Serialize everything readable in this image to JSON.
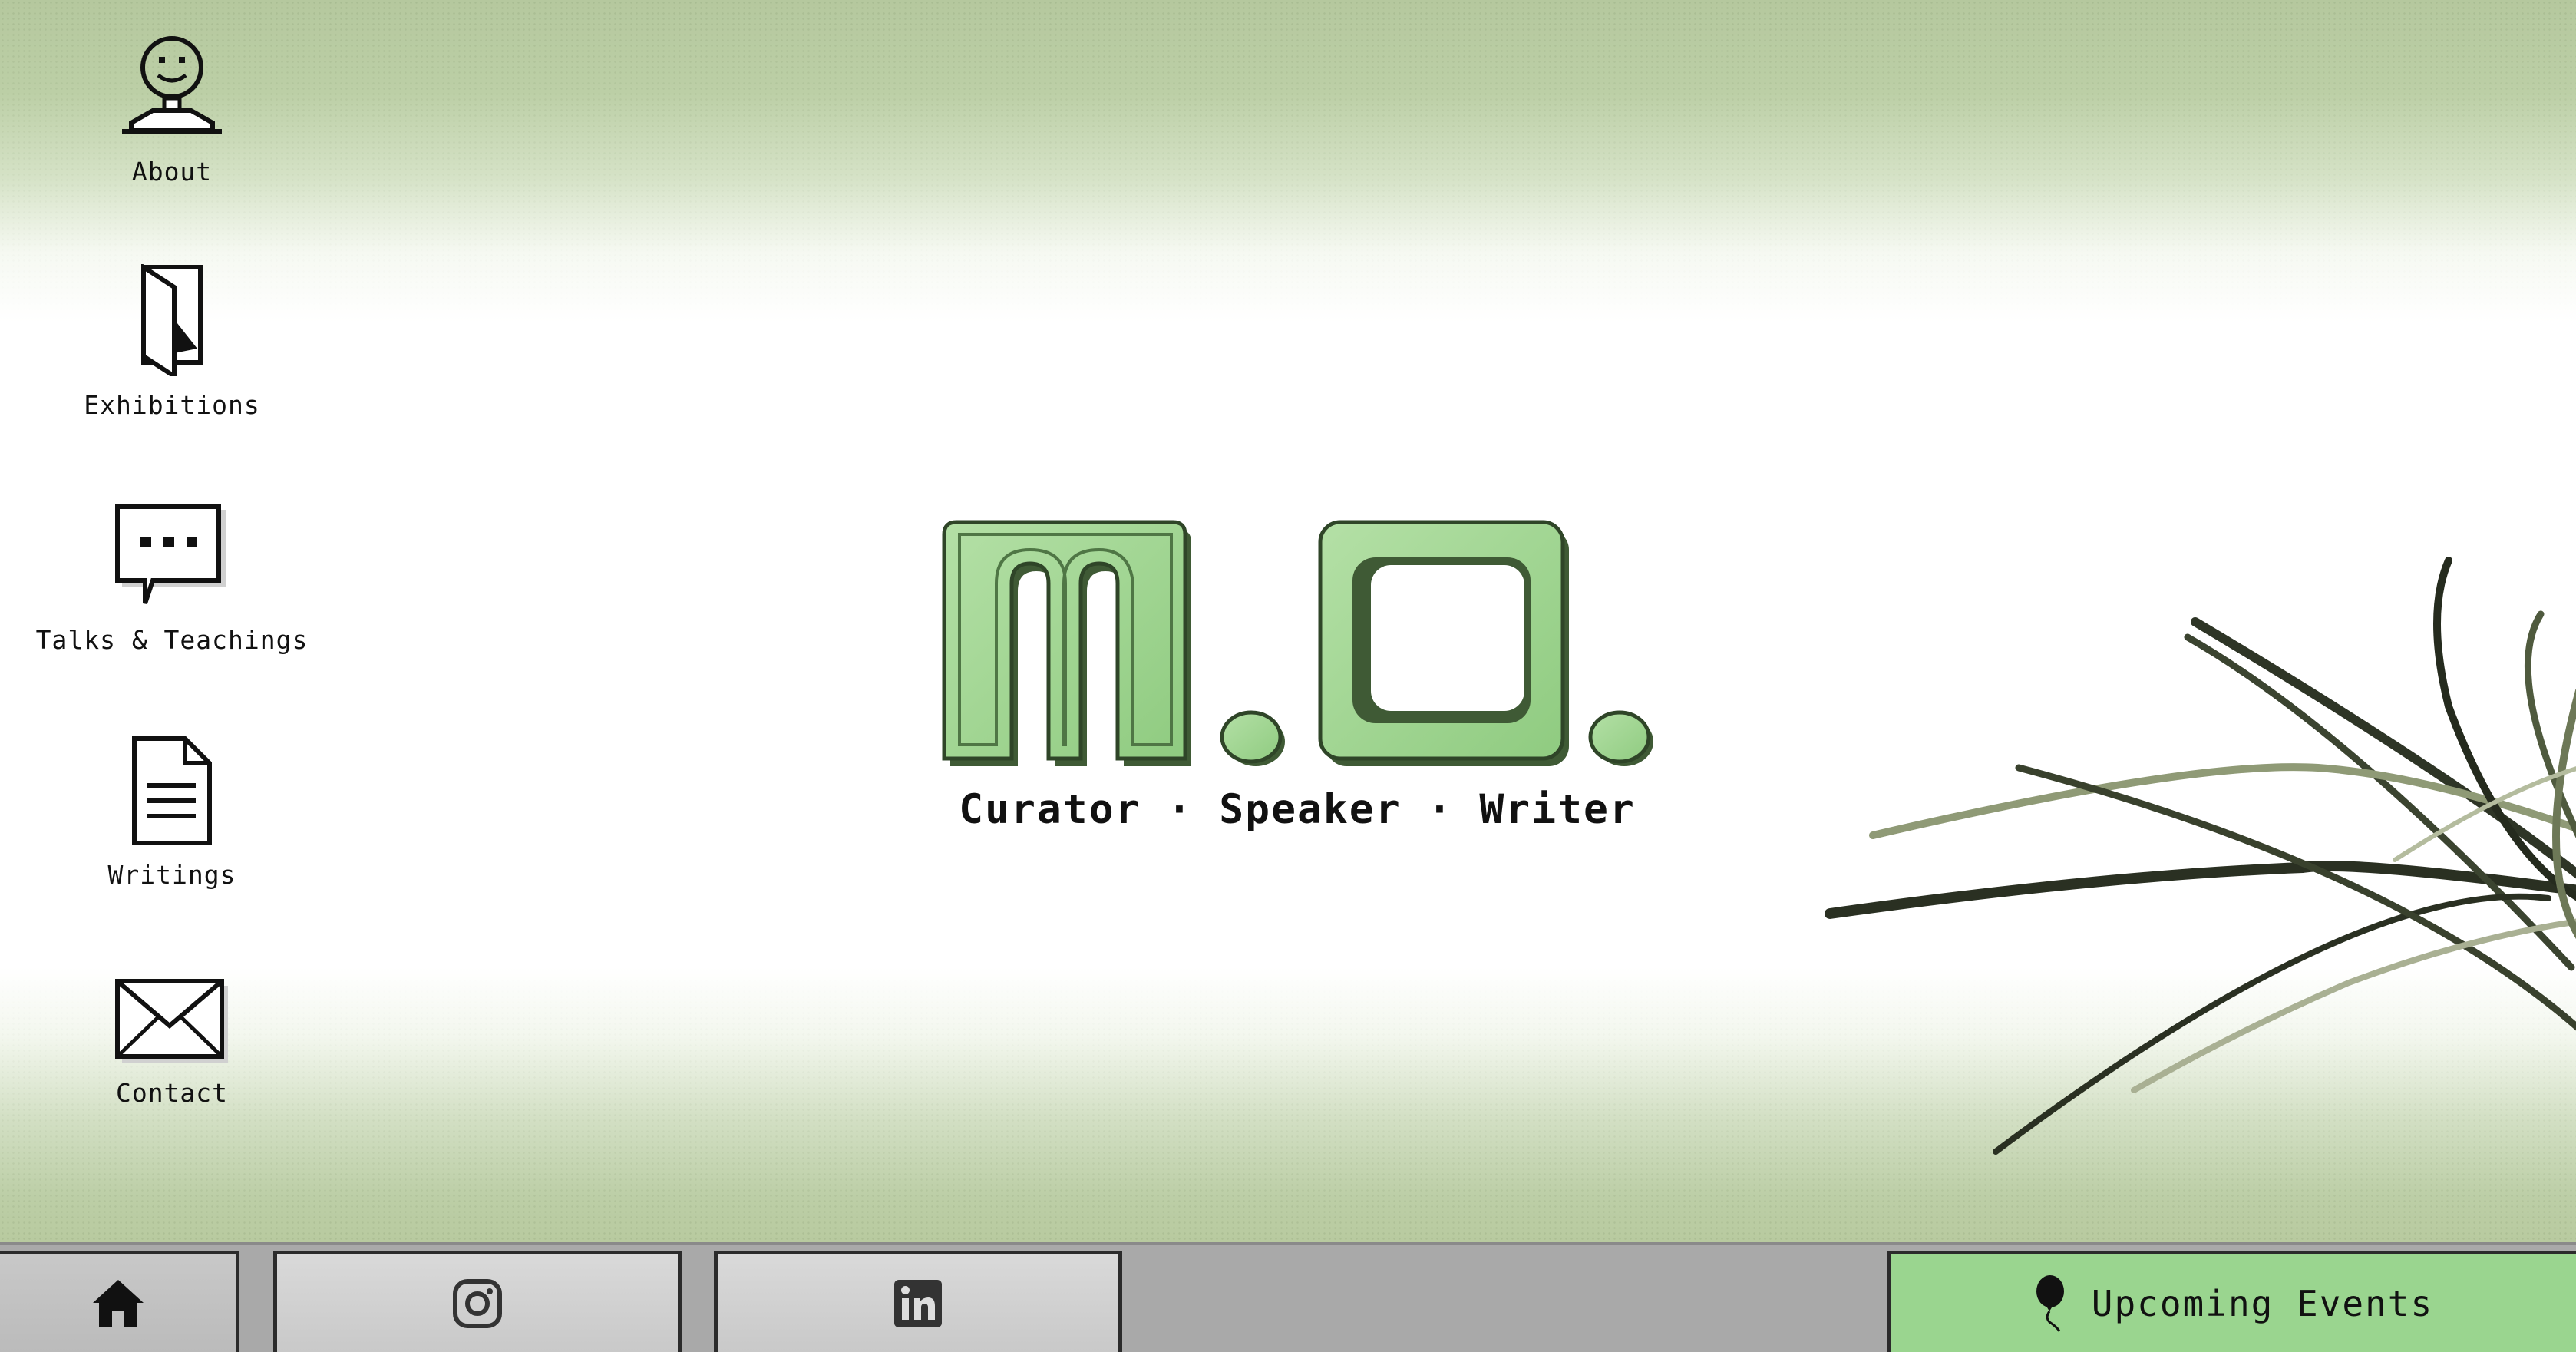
{
  "desktop_icons": [
    {
      "id": "about",
      "label": "About",
      "icon": "smiley-person-icon"
    },
    {
      "id": "exhibitions",
      "label": "Exhibitions",
      "icon": "door-icon"
    },
    {
      "id": "talks",
      "label": "Talks & Teachings",
      "icon": "speech-bubble-icon"
    },
    {
      "id": "writings",
      "label": "Writings",
      "icon": "document-icon"
    },
    {
      "id": "contact",
      "label": "Contact",
      "icon": "envelope-icon"
    }
  ],
  "hero": {
    "logo_text": "m.o.",
    "tagline": "Curator · Speaker · Writer"
  },
  "taskbar": {
    "home_icon": "home-icon",
    "instagram_icon": "instagram-icon",
    "linkedin_icon": "linkedin-icon",
    "events_label": "Upcoming Events",
    "events_icon": "balloon-icon"
  },
  "colors": {
    "accent_green": "#9ad58f",
    "logo_green": "#9fd18f",
    "taskbar_gray": "#a9a9a9",
    "text_dark": "#111111"
  }
}
